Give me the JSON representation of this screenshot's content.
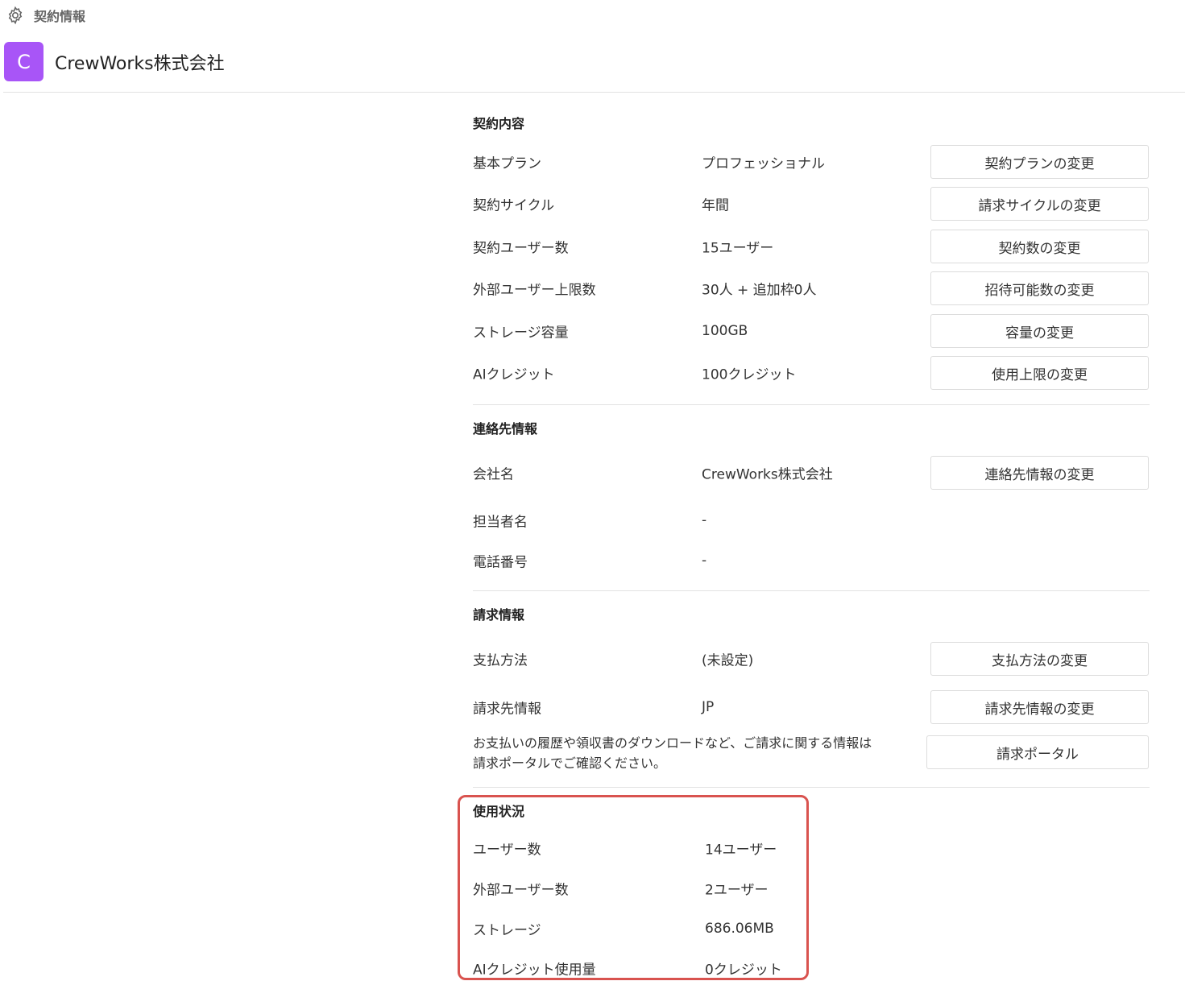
{
  "topbar": {
    "icon": "gear-icon",
    "title": "契約情報"
  },
  "org": {
    "avatar_letter": "C",
    "avatar_color": "#a855f7",
    "name": "CrewWorks株式会社"
  },
  "contract": {
    "title": "契約内容",
    "rows": [
      {
        "label": "基本プラン",
        "value": "プロフェッショナル",
        "button": "契約プランの変更"
      },
      {
        "label": "契約サイクル",
        "value": "年間",
        "button": "請求サイクルの変更"
      },
      {
        "label": "契約ユーザー数",
        "value": "15ユーザー",
        "button": "契約数の変更"
      },
      {
        "label": "外部ユーザー上限数",
        "value": "30人 + 追加枠0人",
        "button": "招待可能数の変更"
      },
      {
        "label": "ストレージ容量",
        "value": "100GB",
        "button": "容量の変更"
      },
      {
        "label": "AIクレジット",
        "value": "100クレジット",
        "button": "使用上限の変更"
      }
    ]
  },
  "contact": {
    "title": "連絡先情報",
    "rows": [
      {
        "label": "会社名",
        "value": "CrewWorks株式会社",
        "button": "連絡先情報の変更"
      },
      {
        "label": "担当者名",
        "value": "-"
      },
      {
        "label": "電話番号",
        "value": "-"
      }
    ]
  },
  "billing": {
    "title": "請求情報",
    "rows": [
      {
        "label": "支払方法",
        "value": "(未設定)",
        "button": "支払方法の変更"
      },
      {
        "label": "請求先情報",
        "value": "JP",
        "button": "請求先情報の変更"
      }
    ],
    "note_line1": "お支払いの履歴や領収書のダウンロードなど、ご請求に関する情報は",
    "note_line2": "請求ポータルでご確認ください。",
    "portal_button": "請求ポータル"
  },
  "usage": {
    "title": "使用状況",
    "highlight_color": "#d9534f",
    "rows": [
      {
        "label": "ユーザー数",
        "value": "14ユーザー"
      },
      {
        "label": "外部ユーザー数",
        "value": "2ユーザー"
      },
      {
        "label": "ストレージ",
        "value": "686.06MB"
      },
      {
        "label": "AIクレジット使用量",
        "value": "0クレジット"
      }
    ]
  }
}
